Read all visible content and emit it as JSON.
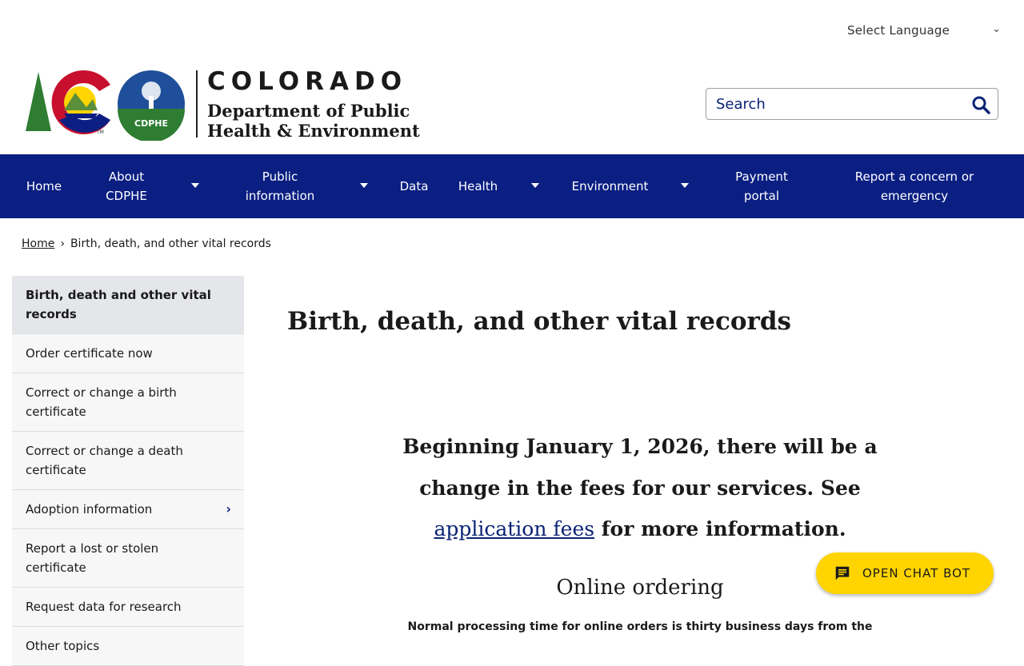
{
  "header": {
    "language_select": "Select Language",
    "logo": {
      "state_name": "COLORADO",
      "department_line1": "Department of Public",
      "department_line2": "Health & Environment",
      "badge_text": "CDPHE",
      "trademark": "TM"
    },
    "search": {
      "placeholder": "Search",
      "icon": "search-icon"
    }
  },
  "nav": {
    "items": [
      {
        "label": "Home"
      },
      {
        "label": "About CDPHE",
        "has_dropdown": true
      },
      {
        "label": "Public information",
        "has_dropdown": true
      },
      {
        "label": "Data"
      },
      {
        "label": "Health",
        "has_dropdown": true
      },
      {
        "label": "Environment",
        "has_dropdown": true
      },
      {
        "label": "Payment portal"
      },
      {
        "label": "Report a concern or emergency"
      }
    ]
  },
  "breadcrumb": {
    "home": "Home",
    "separator": "›",
    "current": "Birth, death, and other vital records"
  },
  "sidebar": {
    "items": [
      {
        "label": "Birth, death and other vital records",
        "active": true
      },
      {
        "label": "Order certificate now"
      },
      {
        "label": "Correct or change a birth certificate"
      },
      {
        "label": "Correct or change a death certificate"
      },
      {
        "label": "Adoption information",
        "has_children": true
      },
      {
        "label": "Report a lost or stolen certificate"
      },
      {
        "label": "Request data for research"
      },
      {
        "label": "Other topics"
      }
    ]
  },
  "main": {
    "title": "Birth, death, and other vital records",
    "notice_before": "Beginning January 1, 2026, there will be a change in the fees for our services. See ",
    "notice_link": "application fees",
    "notice_after": " for more information.",
    "subheading": "Online ordering",
    "paragraph": "Normal processing time for online orders is thirty business days from the"
  },
  "chatbot": {
    "label": "OPEN CHAT BOT",
    "icon": "chat-icon"
  },
  "colors": {
    "nav_bg": "#0b1f82",
    "chat_button": "#ffd400",
    "link": "#0b2375"
  }
}
